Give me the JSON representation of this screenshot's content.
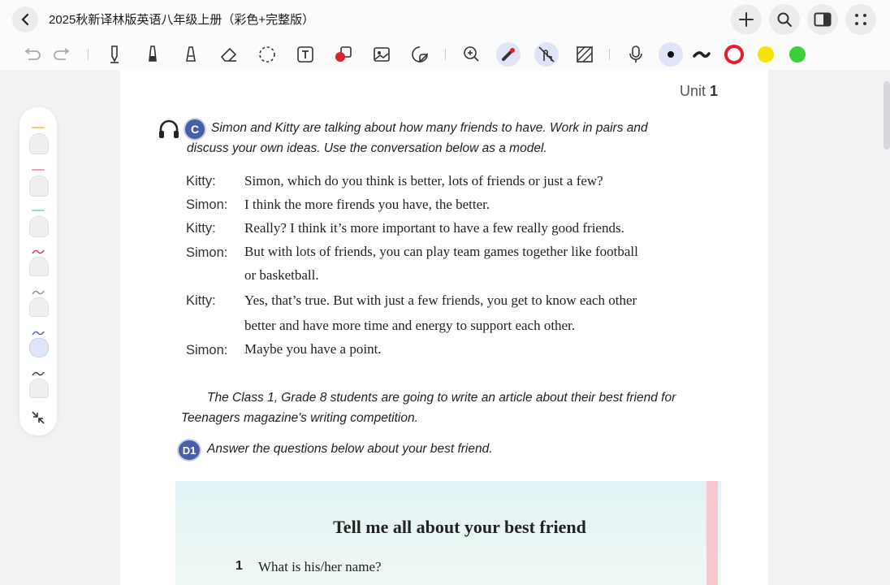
{
  "title_bar": {
    "document_title": "2025秋新译林版英语八年级上册（彩色+完整版）",
    "back_icon": "chevron-left-icon",
    "right_icons": [
      "plus-icon",
      "search-icon",
      "panel-icon",
      "more-dots-icon"
    ]
  },
  "toolbar": {
    "tools": [
      "undo-icon",
      "redo-icon",
      "pen-icon",
      "marker-icon",
      "highlighter-icon",
      "eraser-icon",
      "lasso-icon",
      "text-box-icon",
      "shape-icon",
      "image-icon",
      "sticker-icon",
      "zoom-icon",
      "laser-pointer-icon",
      "touch-draw-icon",
      "hatch-icon",
      "microphone-icon"
    ],
    "colors": [
      "#111111",
      "#222222",
      "#e0202c",
      "#f2e600",
      "#3ccf3c"
    ]
  },
  "side_panel": {
    "pens": [
      {
        "name": "yellow-highlighter",
        "color": "#f3d36a"
      },
      {
        "name": "pink-highlighter",
        "color": "#f0a0b0"
      },
      {
        "name": "green-highlighter",
        "color": "#8fe0b8"
      },
      {
        "name": "red-pen",
        "color": "#c8324a"
      },
      {
        "name": "gray-pen",
        "color": "#888888"
      },
      {
        "name": "blue-pen",
        "color": "#3d55c8"
      },
      {
        "name": "black-pen",
        "color": "#333333"
      }
    ],
    "collapse_icon": "collapse-icon"
  },
  "page": {
    "unit_label": "Unit",
    "unit_number": "1",
    "section_c": {
      "badge": "C",
      "instruction_line1": "Simon and Kitty are talking about how many friends to have. Work in pairs and",
      "instruction_line2": "discuss your own ideas. Use the conversation below as a model."
    },
    "dialogue": [
      {
        "speaker": "Kitty:",
        "line": "Simon, which do you think is better, lots of friends or just a few?"
      },
      {
        "speaker": "Simon:",
        "line": "I think the more firends you have, the better."
      },
      {
        "speaker": "Kitty:",
        "line": "Really? I think it’s more important to have a few really good friends."
      },
      {
        "speaker": "Simon:",
        "line": "But with lots of friends, you can play team games together like football"
      },
      {
        "speaker": "",
        "line": "or basketball."
      },
      {
        "speaker": "Kitty:",
        "line": "Yes, that’s true. But with just a few friends, you get to know each other"
      },
      {
        "speaker": "",
        "line": "better and have more time and energy to support each other."
      },
      {
        "speaker": "Simon:",
        "line": "Maybe you have a point."
      }
    ],
    "section_d": {
      "intro_line1": "The Class 1, Grade 8 students are going to write an article about their best friend for",
      "intro_line2": "Teenagers magazine's writing competition.",
      "d1_badge": "D1",
      "d1_instruction": "Answer the questions below about your best friend."
    },
    "friend_box": {
      "title": "Tell me all about your best friend",
      "question_number": "1",
      "question": "What is his/her name?"
    }
  }
}
